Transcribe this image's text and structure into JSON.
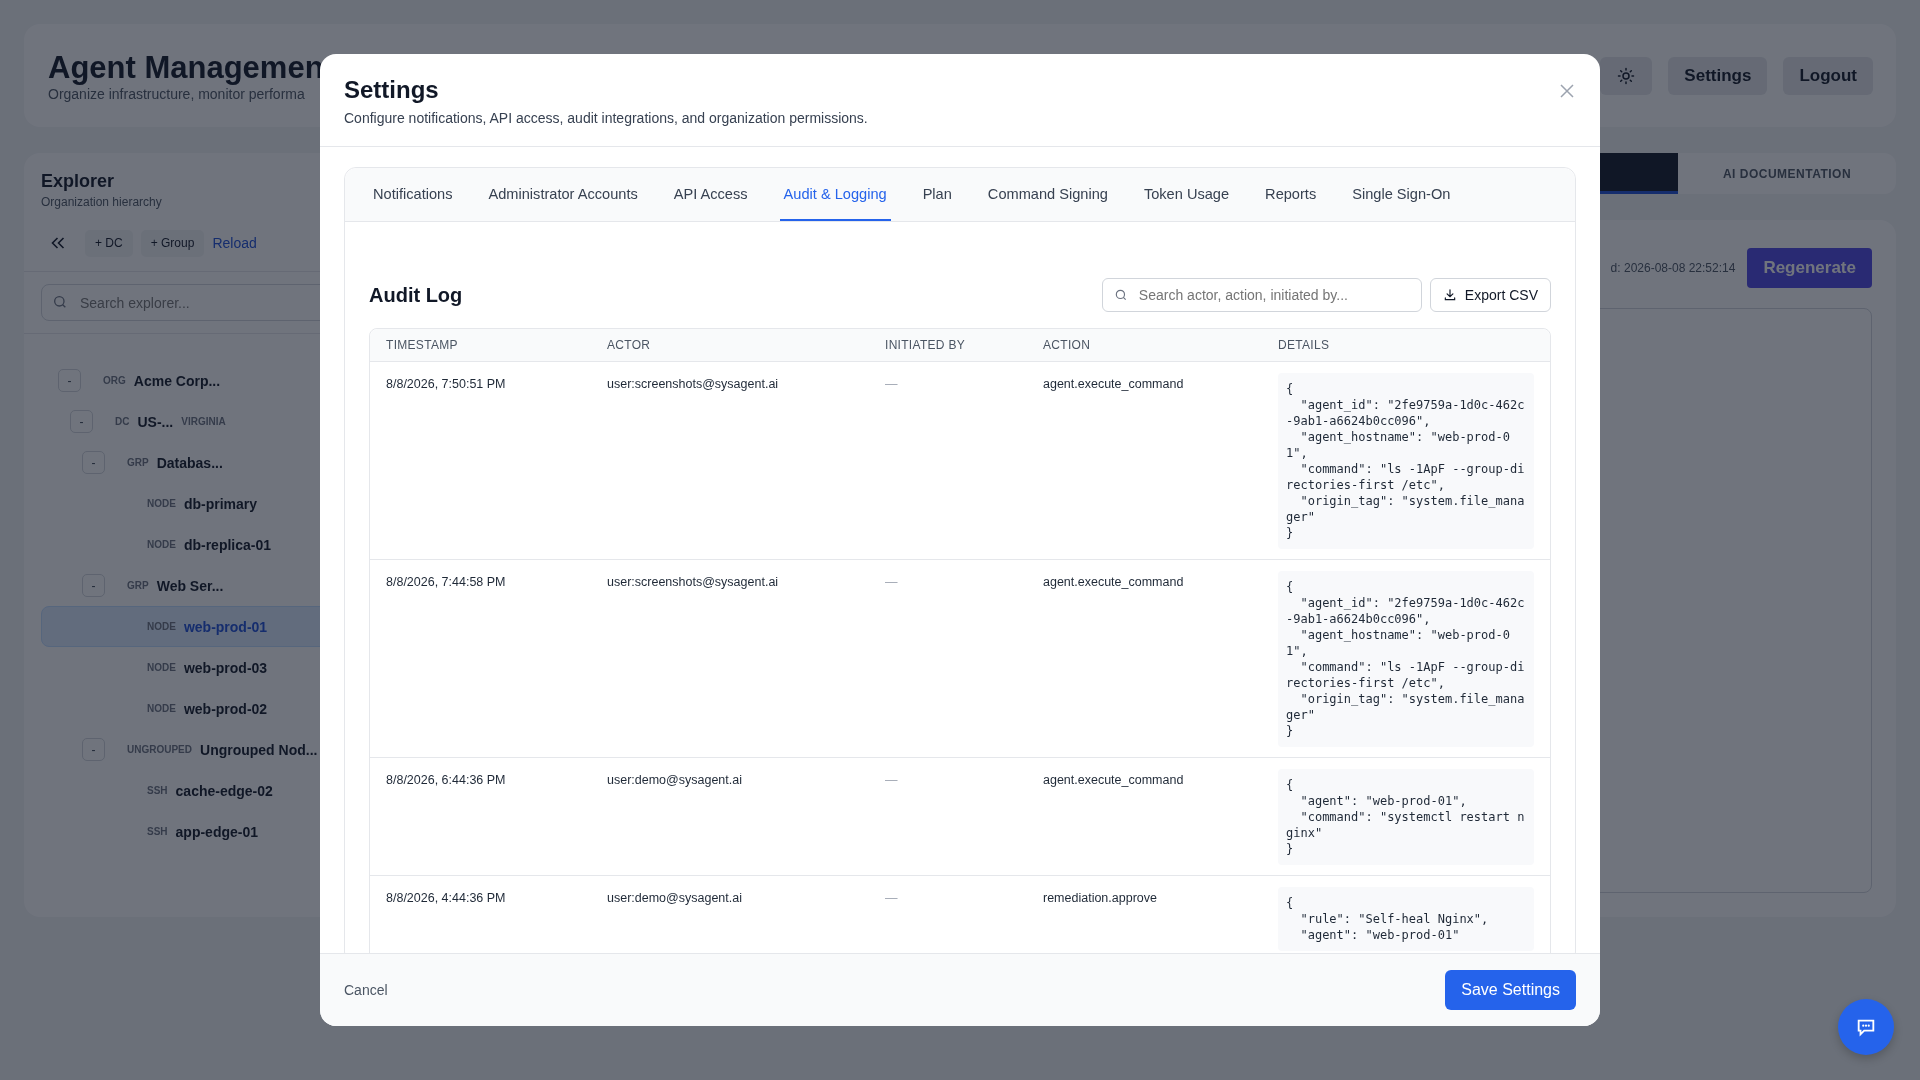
{
  "header": {
    "title": "Agent Managemen",
    "subtitle": "Organize infrastructure, monitor performa",
    "buttons": [
      {
        "kind": "theme"
      },
      {
        "kind": "text",
        "label": "Settings"
      },
      {
        "kind": "text",
        "label": "Logout"
      }
    ]
  },
  "explorer": {
    "title": "Explorer",
    "subtitle": "Organization hierarchy",
    "actions": [
      {
        "kind": "collapse"
      },
      {
        "kind": "chip",
        "label": "+ DC"
      },
      {
        "kind": "chip",
        "label": "+ Group"
      },
      {
        "kind": "link",
        "label": "Reload"
      }
    ],
    "search": {
      "placeholder": "Search explorer..."
    },
    "tree": [
      {
        "toggle": "-",
        "type": "ORG",
        "name": "Acme Corp...",
        "selected": false,
        "children": [
          {
            "toggle": "-",
            "type": "DC",
            "name": "US-...",
            "tag": "VIRGINIA",
            "selected": false,
            "children": [
              {
                "toggle": "-",
                "type": "GRP",
                "name": "Databas...",
                "selected": false,
                "children": [
                  {
                    "type": "NODE",
                    "name": "db-primary",
                    "selected": false
                  },
                  {
                    "type": "NODE",
                    "name": "db-replica-01",
                    "selected": false
                  }
                ]
              },
              {
                "toggle": "-",
                "type": "GRP",
                "name": "Web Ser...",
                "selected": false,
                "children": [
                  {
                    "type": "NODE",
                    "name": "web-prod-01",
                    "selected": true
                  },
                  {
                    "type": "NODE",
                    "name": "web-prod-03",
                    "selected": false
                  },
                  {
                    "type": "NODE",
                    "name": "web-prod-02",
                    "selected": false
                  }
                ]
              },
              {
                "toggle": "-",
                "type": "UNGROUPED",
                "name": "Ungrouped Nod...",
                "selected": false,
                "children": [
                  {
                    "type": "SSH",
                    "name": "cache-edge-02",
                    "selected": false
                  },
                  {
                    "type": "SSH",
                    "name": "app-edge-01",
                    "selected": false
                  }
                ]
              }
            ]
          }
        ]
      }
    ]
  },
  "main": {
    "tabs": [
      {
        "selected": true
      },
      {
        "label": "AI DOCUMENTATION",
        "selected": false
      }
    ],
    "generated": "d: 2026-08-08 22:52:14",
    "regenerate": "Regenerate"
  },
  "modal": {
    "title": "Settings",
    "subtitle": "Configure notifications, API access, audit integrations, and organization permissions.",
    "tabs": [
      {
        "label": "Notifications",
        "selected": false
      },
      {
        "label": "Administrator Accounts",
        "selected": false
      },
      {
        "label": "API Access",
        "selected": false
      },
      {
        "label": "Audit & Logging",
        "selected": true
      },
      {
        "label": "Plan",
        "selected": false
      },
      {
        "label": "Command Signing",
        "selected": false
      },
      {
        "label": "Token Usage",
        "selected": false
      },
      {
        "label": "Reports",
        "selected": false
      },
      {
        "label": "Single Sign-On",
        "selected": false
      }
    ],
    "section_title": "Audit Log",
    "search": {
      "placeholder": "Search actor, action, initiated by..."
    },
    "export": "Export CSV",
    "table": {
      "columns": [
        "TIMESTAMP",
        "ACTOR",
        "INITIATED BY",
        "ACTION",
        "DETAILS"
      ],
      "rows": [
        {
          "timestamp": "8/8/2026, 7:50:51 PM",
          "actor": "user:screenshots@sysagent.ai",
          "initiated_by": "—",
          "action": "agent.execute_command",
          "details": "{\n  \"agent_id\": \"2fe9759a-1d0c-462c-9ab1-a6624b0cc096\",\n  \"agent_hostname\": \"web-prod-01\",\n  \"command\": \"ls -1ApF --group-directories-first /etc\",\n  \"origin_tag\": \"system.file_manager\"\n}"
        },
        {
          "timestamp": "8/8/2026, 7:44:58 PM",
          "actor": "user:screenshots@sysagent.ai",
          "initiated_by": "—",
          "action": "agent.execute_command",
          "details": "{\n  \"agent_id\": \"2fe9759a-1d0c-462c-9ab1-a6624b0cc096\",\n  \"agent_hostname\": \"web-prod-01\",\n  \"command\": \"ls -1ApF --group-directories-first /etc\",\n  \"origin_tag\": \"system.file_manager\"\n}"
        },
        {
          "timestamp": "8/8/2026, 6:44:36 PM",
          "actor": "user:demo@sysagent.ai",
          "initiated_by": "—",
          "action": "agent.execute_command",
          "details": "{\n  \"agent\": \"web-prod-01\",\n  \"command\": \"systemctl restart nginx\"\n}"
        },
        {
          "timestamp": "8/8/2026, 4:44:36 PM",
          "actor": "user:demo@sysagent.ai",
          "initiated_by": "—",
          "action": "remediation.approve",
          "details": "{\n  \"rule\": \"Self-heal Nginx\",\n  \"agent\": \"web-prod-01\""
        }
      ]
    },
    "cancel": "Cancel",
    "save": "Save Settings"
  },
  "chat": {
    "kind": "chat"
  }
}
